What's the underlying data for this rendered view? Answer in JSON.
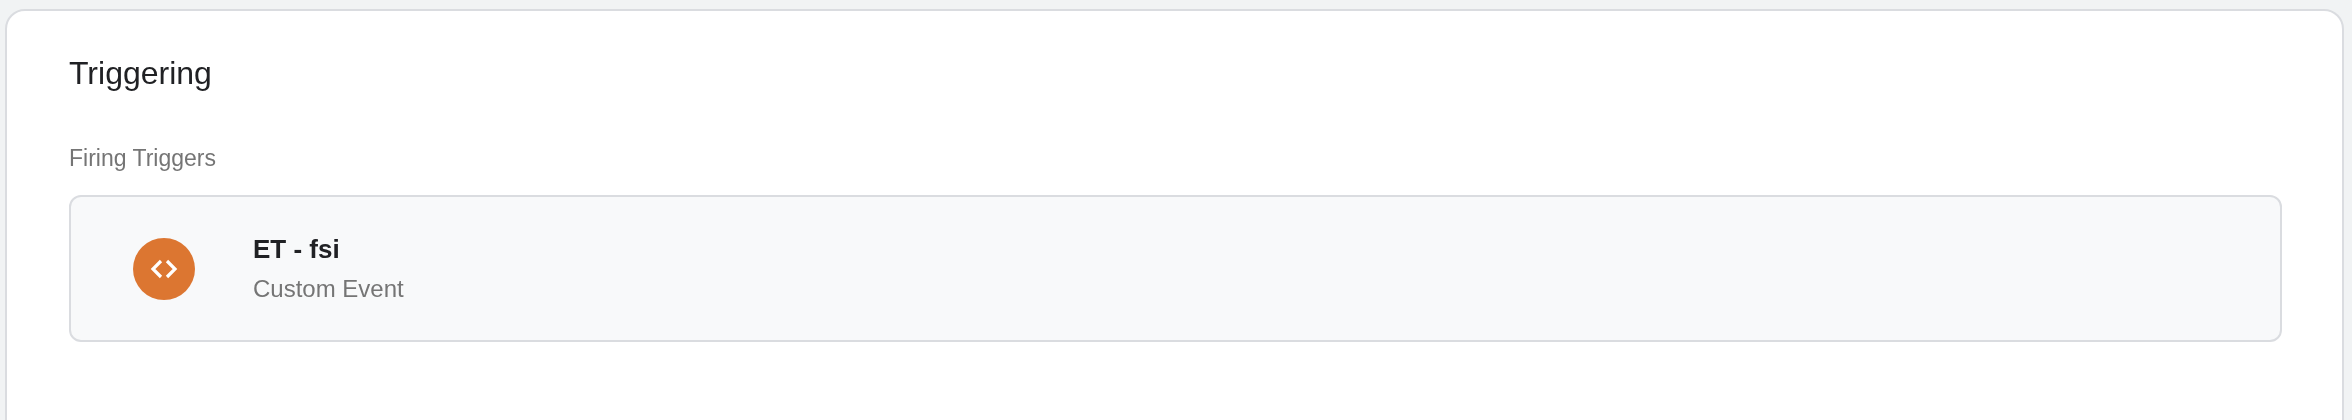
{
  "section": {
    "title": "Triggering",
    "label": "Firing Triggers"
  },
  "triggers": [
    {
      "name": "ET - fsi",
      "type": "Custom Event",
      "kind": "custom-event",
      "color": "#dc7631"
    }
  ]
}
